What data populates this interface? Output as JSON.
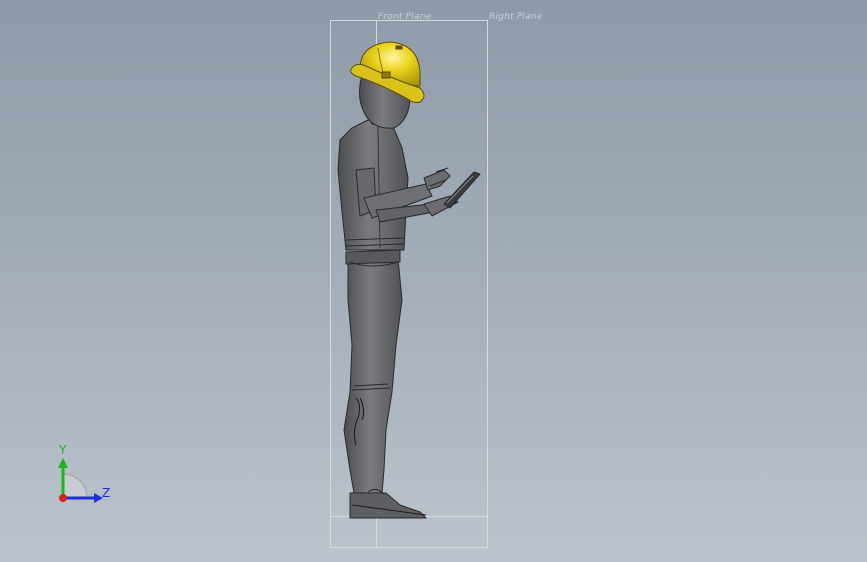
{
  "viewport": {
    "planes": {
      "front_plane_label": "Front Plane",
      "right_plane_label": "Right Plane"
    },
    "model": {
      "helmet_color": "#e8d21a",
      "body_color": "#6b6d70",
      "edge_color": "#2a2a2a"
    },
    "triad": {
      "y_label": "Y",
      "z_label": "Z",
      "y_color": "#1fb31f",
      "z_color": "#1f2fd6",
      "x_color": "#d62020"
    }
  }
}
